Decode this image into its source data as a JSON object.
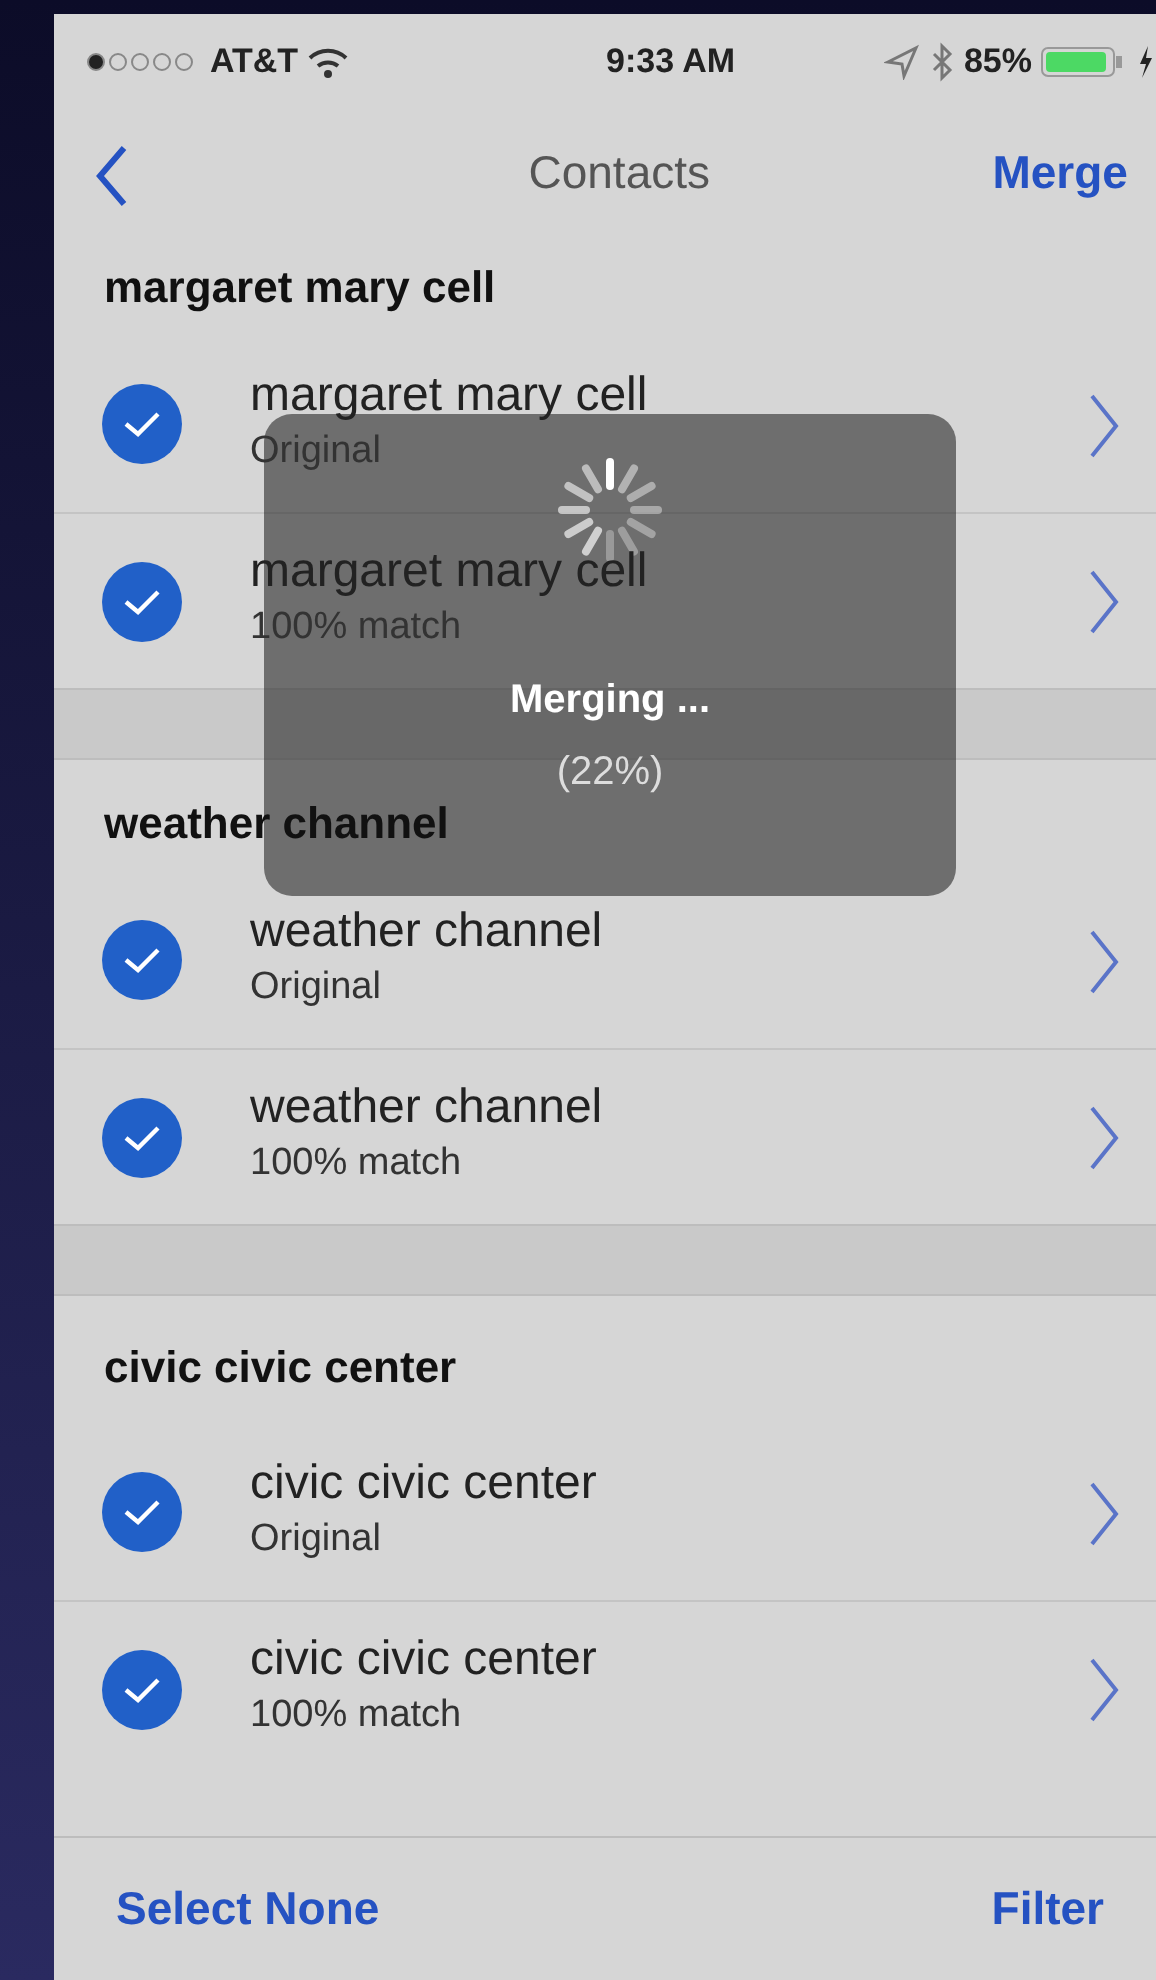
{
  "status_bar": {
    "carrier": "AT&T",
    "time": "9:33 AM",
    "battery": "85%"
  },
  "nav_bar": {
    "title": "Contacts",
    "action": "Merge"
  },
  "groups": [
    {
      "title": "margaret mary cell",
      "contacts": [
        {
          "name": "margaret mary cell",
          "subtitle": "Original",
          "checked": true
        },
        {
          "name": "margaret mary cell",
          "subtitle": "100% match",
          "checked": true
        }
      ]
    },
    {
      "title": "weather channel",
      "contacts": [
        {
          "name": "weather channel",
          "subtitle": "Original",
          "checked": true
        },
        {
          "name": "weather channel",
          "subtitle": "100% match",
          "checked": true
        }
      ]
    },
    {
      "title": "civic civic center",
      "contacts": [
        {
          "name": "civic civic center",
          "subtitle": "Original",
          "checked": true
        },
        {
          "name": "civic civic center",
          "subtitle": "100% match",
          "checked": true
        }
      ]
    }
  ],
  "toolbar": {
    "left": "Select None",
    "right": "Filter"
  },
  "overlay": {
    "message": "Merging ...",
    "progress": "(22%)"
  }
}
